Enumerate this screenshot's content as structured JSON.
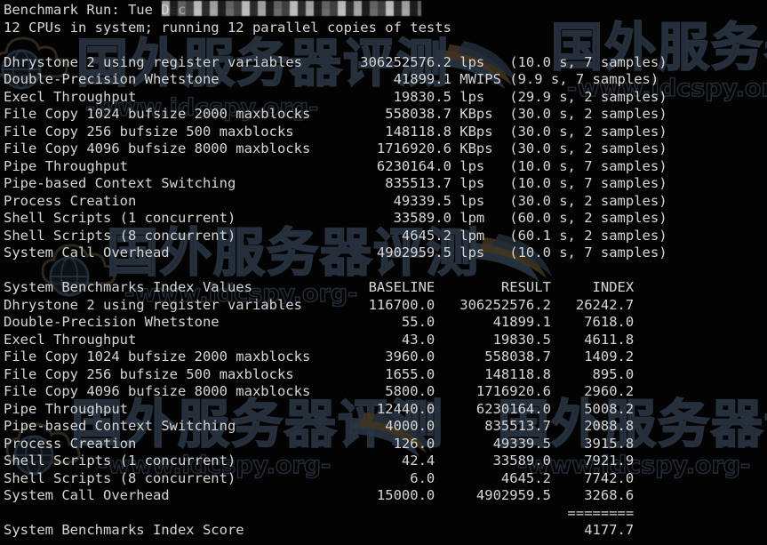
{
  "terminal": {
    "header": {
      "run_line_prefix": "Benchmark Run: Tue Dec",
      "run_line_redacted": true,
      "cpu_line": "12 CPUs in system; running 12 parallel copies of tests"
    },
    "results_block": {
      "rows": [
        {
          "name": "Dhrystone 2 using register variables",
          "value": "306252576.2",
          "unit": "lps",
          "timing": "(10.0 s, 7 samples)"
        },
        {
          "name": "Double-Precision Whetstone",
          "value": "41899.1",
          "unit": "MWIPS",
          "timing": "(9.9 s, 7 samples)"
        },
        {
          "name": "Execl Throughput",
          "value": "19830.5",
          "unit": "lps",
          "timing": "(29.9 s, 2 samples)"
        },
        {
          "name": "File Copy 1024 bufsize 2000 maxblocks",
          "value": "558038.7",
          "unit": "KBps",
          "timing": "(30.0 s, 2 samples)"
        },
        {
          "name": "File Copy 256 bufsize 500 maxblocks",
          "value": "148118.8",
          "unit": "KBps",
          "timing": "(30.0 s, 2 samples)"
        },
        {
          "name": "File Copy 4096 bufsize 8000 maxblocks",
          "value": "1716920.6",
          "unit": "KBps",
          "timing": "(30.0 s, 2 samples)"
        },
        {
          "name": "Pipe Throughput",
          "value": "6230164.0",
          "unit": "lps",
          "timing": "(10.0 s, 7 samples)"
        },
        {
          "name": "Pipe-based Context Switching",
          "value": "835513.7",
          "unit": "lps",
          "timing": "(10.0 s, 7 samples)"
        },
        {
          "name": "Process Creation",
          "value": "49339.5",
          "unit": "lps",
          "timing": "(30.0 s, 2 samples)"
        },
        {
          "name": "Shell Scripts (1 concurrent)",
          "value": "33589.0",
          "unit": "lpm",
          "timing": "(60.0 s, 2 samples)"
        },
        {
          "name": "Shell Scripts (8 concurrent)",
          "value": "4645.2",
          "unit": "lpm",
          "timing": "(60.1 s, 2 samples)"
        },
        {
          "name": "System Call Overhead",
          "value": "4902959.5",
          "unit": "lps",
          "timing": "(10.0 s, 7 samples)"
        }
      ]
    },
    "index_block": {
      "title": "System Benchmarks Index Values",
      "columns": [
        "BASELINE",
        "RESULT",
        "INDEX"
      ],
      "rows": [
        {
          "name": "Dhrystone 2 using register variables",
          "baseline": "116700.0",
          "result": "306252576.2",
          "index": "26242.7"
        },
        {
          "name": "Double-Precision Whetstone",
          "baseline": "55.0",
          "result": "41899.1",
          "index": "7618.0"
        },
        {
          "name": "Execl Throughput",
          "baseline": "43.0",
          "result": "19830.5",
          "index": "4611.8"
        },
        {
          "name": "File Copy 1024 bufsize 2000 maxblocks",
          "baseline": "3960.0",
          "result": "558038.7",
          "index": "1409.2"
        },
        {
          "name": "File Copy 256 bufsize 500 maxblocks",
          "baseline": "1655.0",
          "result": "148118.8",
          "index": "895.0"
        },
        {
          "name": "File Copy 4096 bufsize 8000 maxblocks",
          "baseline": "5800.0",
          "result": "1716920.6",
          "index": "2960.2"
        },
        {
          "name": "Pipe Throughput",
          "baseline": "12440.0",
          "result": "6230164.0",
          "index": "5008.2"
        },
        {
          "name": "Pipe-based Context Switching",
          "baseline": "4000.0",
          "result": "835513.7",
          "index": "2088.8"
        },
        {
          "name": "Process Creation",
          "baseline": "126.0",
          "result": "49339.5",
          "index": "3915.8"
        },
        {
          "name": "Shell Scripts (1 concurrent)",
          "baseline": "42.4",
          "result": "33589.0",
          "index": "7921.9"
        },
        {
          "name": "Shell Scripts (8 concurrent)",
          "baseline": "6.0",
          "result": "4645.2",
          "index": "7742.0"
        },
        {
          "name": "System Call Overhead",
          "baseline": "15000.0",
          "result": "4902959.5",
          "index": "3268.6"
        }
      ],
      "separator": "========",
      "score_label": "System Benchmarks Index Score",
      "score_value": "4177.7"
    }
  },
  "watermark": {
    "cn_text": "国外服务器评测",
    "url_text": "-www.idcspy.org-",
    "stroke_color": "#2a3442",
    "logo_name": "cloud-globe-logo",
    "swoosh_name": "wave-swoosh"
  },
  "colors": {
    "background": "#030303",
    "text": "#d6d6d6",
    "watermark": "#2a3442"
  }
}
